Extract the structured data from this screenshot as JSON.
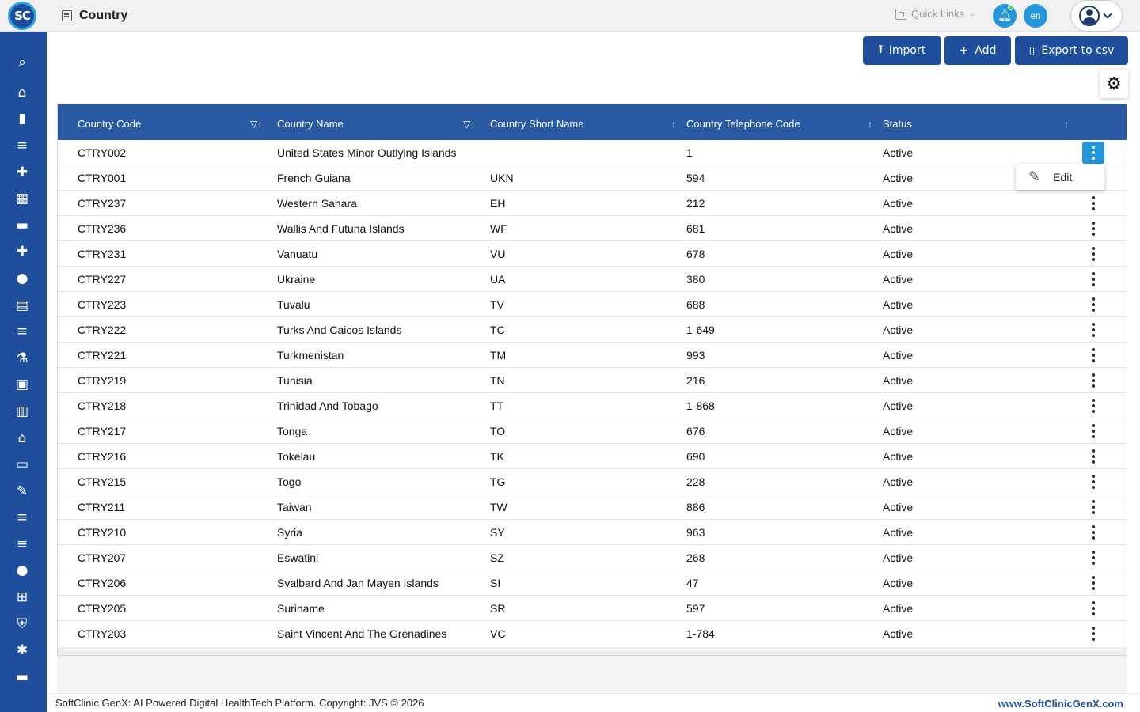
{
  "header": {
    "logo": "SC",
    "title": "Country",
    "quick_links": "Quick Links",
    "lang": "en"
  },
  "sidebar": {
    "items": [
      {
        "icon": "search-icon",
        "glyph": "⌕"
      },
      {
        "icon": "home-icon",
        "glyph": "⌂"
      },
      {
        "icon": "bar-chart-icon",
        "glyph": "▮"
      },
      {
        "icon": "menu-icon",
        "glyph": "≡"
      },
      {
        "icon": "medical-bag-icon",
        "glyph": "✚"
      },
      {
        "icon": "calendar-icon",
        "glyph": "▦"
      },
      {
        "icon": "bed-icon",
        "glyph": "▬"
      },
      {
        "icon": "medical-plus-icon",
        "glyph": "✚"
      },
      {
        "icon": "person-icon",
        "glyph": "●"
      },
      {
        "icon": "document-icon",
        "glyph": "▤"
      },
      {
        "icon": "list-icon",
        "glyph": "≡"
      },
      {
        "icon": "lab-icon",
        "glyph": "⚗"
      },
      {
        "icon": "pharmacy-icon",
        "glyph": "▣"
      },
      {
        "icon": "book-icon",
        "glyph": "▥"
      },
      {
        "icon": "hospital-icon",
        "glyph": "⌂"
      },
      {
        "icon": "devices-icon",
        "glyph": "▭"
      },
      {
        "icon": "wrench-icon",
        "glyph": "✎"
      },
      {
        "icon": "list-icon",
        "glyph": "≡"
      },
      {
        "icon": "list-icon",
        "glyph": "≡"
      },
      {
        "icon": "blood-drop-icon",
        "glyph": "●"
      },
      {
        "icon": "add-box-icon",
        "glyph": "⊞"
      },
      {
        "icon": "shield-icon",
        "glyph": "⛨"
      },
      {
        "icon": "network-icon",
        "glyph": "✱"
      },
      {
        "icon": "folder-icon",
        "glyph": "▬"
      }
    ]
  },
  "actions": {
    "import": "Import",
    "add": "Add",
    "export": "Export to csv"
  },
  "table": {
    "columns": {
      "code": "Country Code",
      "name": "Country Name",
      "short": "Country Short Name",
      "tel": "Country Telephone Code",
      "status": "Status"
    },
    "rows": [
      {
        "code": "CTRY002",
        "name": "United States Minor Outlying Islands",
        "short": "",
        "tel": "1",
        "status": "Active"
      },
      {
        "code": "CTRY001",
        "name": "French Guiana",
        "short": "UKN",
        "tel": "594",
        "status": "Active"
      },
      {
        "code": "CTRY237",
        "name": "Western Sahara",
        "short": "EH",
        "tel": "212",
        "status": "Active"
      },
      {
        "code": "CTRY236",
        "name": "Wallis And Futuna Islands",
        "short": "WF",
        "tel": "681",
        "status": "Active"
      },
      {
        "code": "CTRY231",
        "name": "Vanuatu",
        "short": "VU",
        "tel": "678",
        "status": "Active"
      },
      {
        "code": "CTRY227",
        "name": "Ukraine",
        "short": "UA",
        "tel": "380",
        "status": "Active"
      },
      {
        "code": "CTRY223",
        "name": "Tuvalu",
        "short": "TV",
        "tel": "688",
        "status": "Active"
      },
      {
        "code": "CTRY222",
        "name": "Turks And Caicos Islands",
        "short": "TC",
        "tel": "1-649",
        "status": "Active"
      },
      {
        "code": "CTRY221",
        "name": "Turkmenistan",
        "short": "TM",
        "tel": "993",
        "status": "Active"
      },
      {
        "code": "CTRY219",
        "name": "Tunisia",
        "short": "TN",
        "tel": "216",
        "status": "Active"
      },
      {
        "code": "CTRY218",
        "name": "Trinidad And Tobago",
        "short": "TT",
        "tel": "1-868",
        "status": "Active"
      },
      {
        "code": "CTRY217",
        "name": "Tonga",
        "short": "TO",
        "tel": "676",
        "status": "Active"
      },
      {
        "code": "CTRY216",
        "name": "Tokelau",
        "short": "TK",
        "tel": "690",
        "status": "Active"
      },
      {
        "code": "CTRY215",
        "name": "Togo",
        "short": "TG",
        "tel": "228",
        "status": "Active"
      },
      {
        "code": "CTRY211",
        "name": "Taiwan",
        "short": "TW",
        "tel": "886",
        "status": "Active"
      },
      {
        "code": "CTRY210",
        "name": "Syria",
        "short": "SY",
        "tel": "963",
        "status": "Active"
      },
      {
        "code": "CTRY207",
        "name": "Eswatini",
        "short": "SZ",
        "tel": "268",
        "status": "Active"
      },
      {
        "code": "CTRY206",
        "name": "Svalbard And Jan Mayen Islands",
        "short": "SI",
        "tel": "47",
        "status": "Active"
      },
      {
        "code": "CTRY205",
        "name": "Suriname",
        "short": "SR",
        "tel": "597",
        "status": "Active"
      },
      {
        "code": "CTRY203",
        "name": "Saint Vincent And The Grenadines",
        "short": "VC",
        "tel": "1-784",
        "status": "Active"
      }
    ]
  },
  "row_menu": {
    "edit": "Edit"
  },
  "footer": {
    "left": "SoftClinic GenX: AI Powered Digital HealthTech Platform. Copyright: JVS © 2026",
    "right": "www.SoftClinicGenX.com"
  },
  "colors": {
    "primary": "#1f4f9c",
    "header_row": "#2a5aa4",
    "accent": "#2497d8"
  }
}
